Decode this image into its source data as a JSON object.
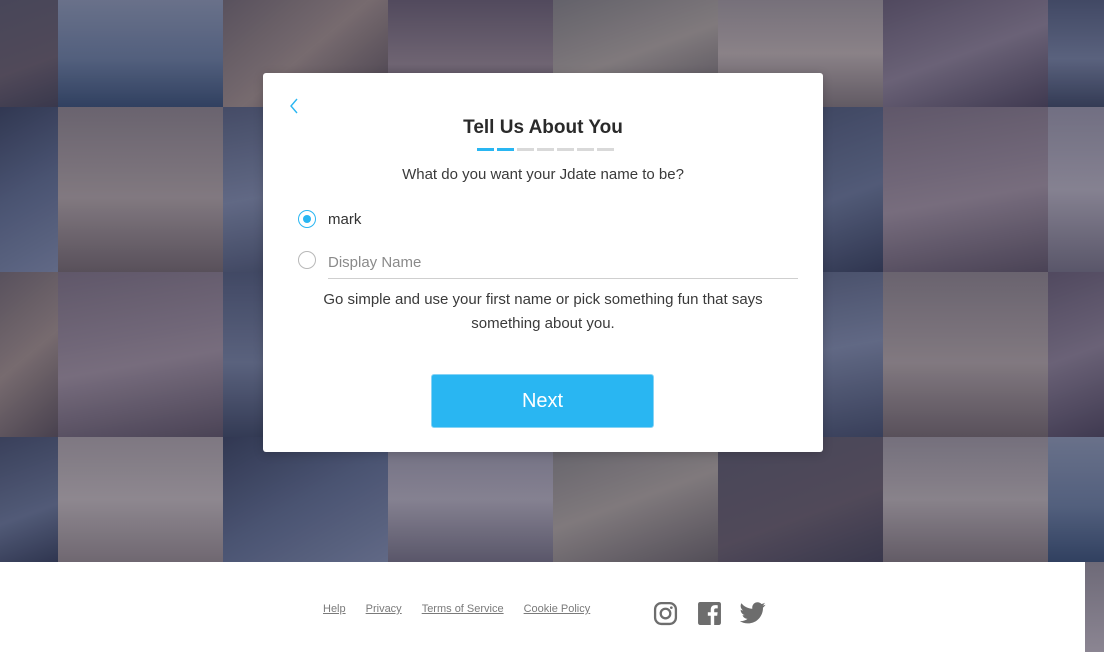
{
  "modal": {
    "title": "Tell Us About You",
    "progress": {
      "total": 7,
      "completed": 2
    },
    "question": "What do you want your Jdate name to be?",
    "options": [
      {
        "label": "mark",
        "selected": true
      }
    ],
    "display_name": {
      "placeholder": "Display Name",
      "value": "",
      "selected": false
    },
    "helper_text": "Go simple and use your first name or pick something fun that says something about you.",
    "next_label": "Next",
    "accent_color": "#29b6f2"
  },
  "footer": {
    "links": [
      "Help",
      "Privacy",
      "Terms of Service",
      "Cookie Policy"
    ],
    "social_icons": [
      "instagram-icon",
      "facebook-icon",
      "twitter-icon"
    ],
    "link_color": "#7a7a7a",
    "icon_color": "#6d6d6d"
  }
}
